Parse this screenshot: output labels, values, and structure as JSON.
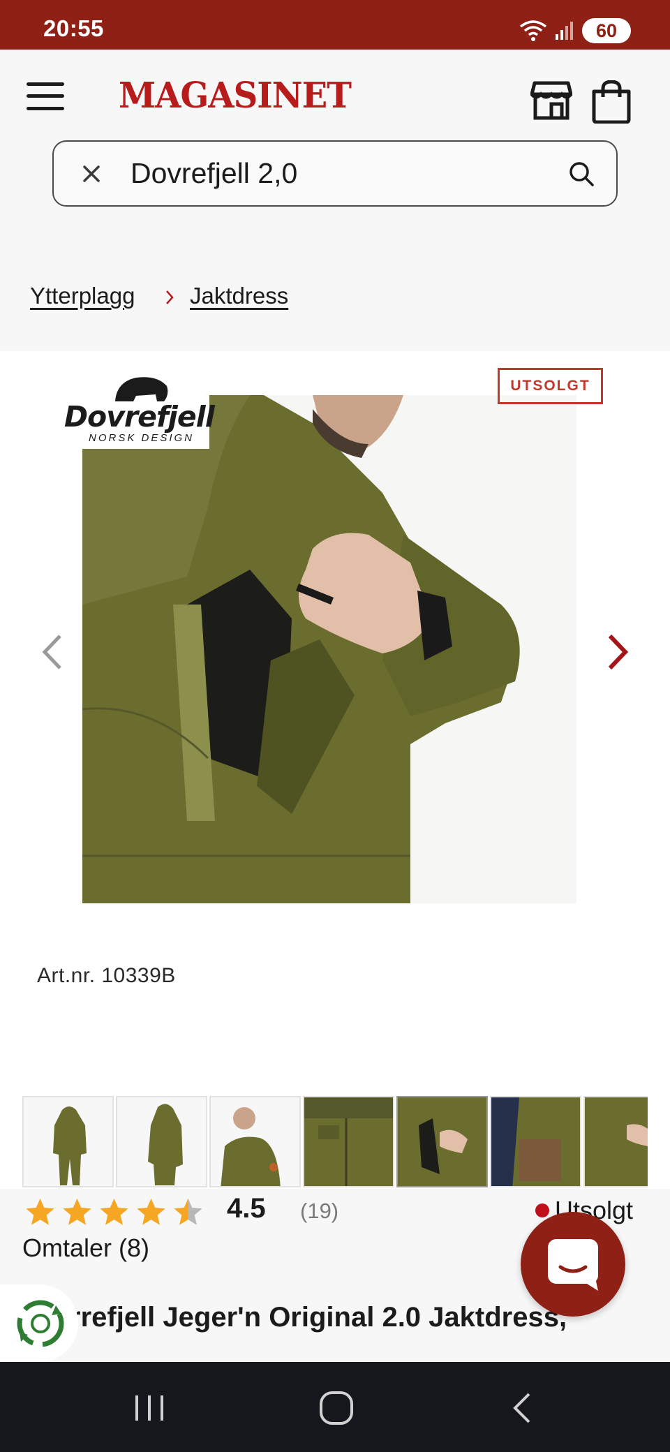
{
  "status_bar": {
    "time": "20:55",
    "battery": "60"
  },
  "header": {
    "logo": "MAGASINET"
  },
  "search": {
    "value": "Dovrefjell 2,0"
  },
  "breadcrumb": {
    "items": [
      "Ytterplagg",
      "Jaktdress"
    ]
  },
  "product": {
    "brand": {
      "name": "Dovrefjell",
      "tagline": "NORSK DESIGN"
    },
    "badge": "UTSOLGT",
    "art_nr": "Art.nr. 10339B",
    "rating": {
      "value": "4.5",
      "stars": 4.5,
      "count": "(19)"
    },
    "stock": "Utsolgt",
    "reviews": "Omtaler (8)",
    "title_visible": "rrefjell Jeger'n Original 2.0 Jaktdress,"
  },
  "colors": {
    "brand_red": "#8e2015",
    "logo_red": "#b71b1b",
    "star": "#f5a623",
    "badge": "#c0392b",
    "olive": "#6b6d2f"
  }
}
